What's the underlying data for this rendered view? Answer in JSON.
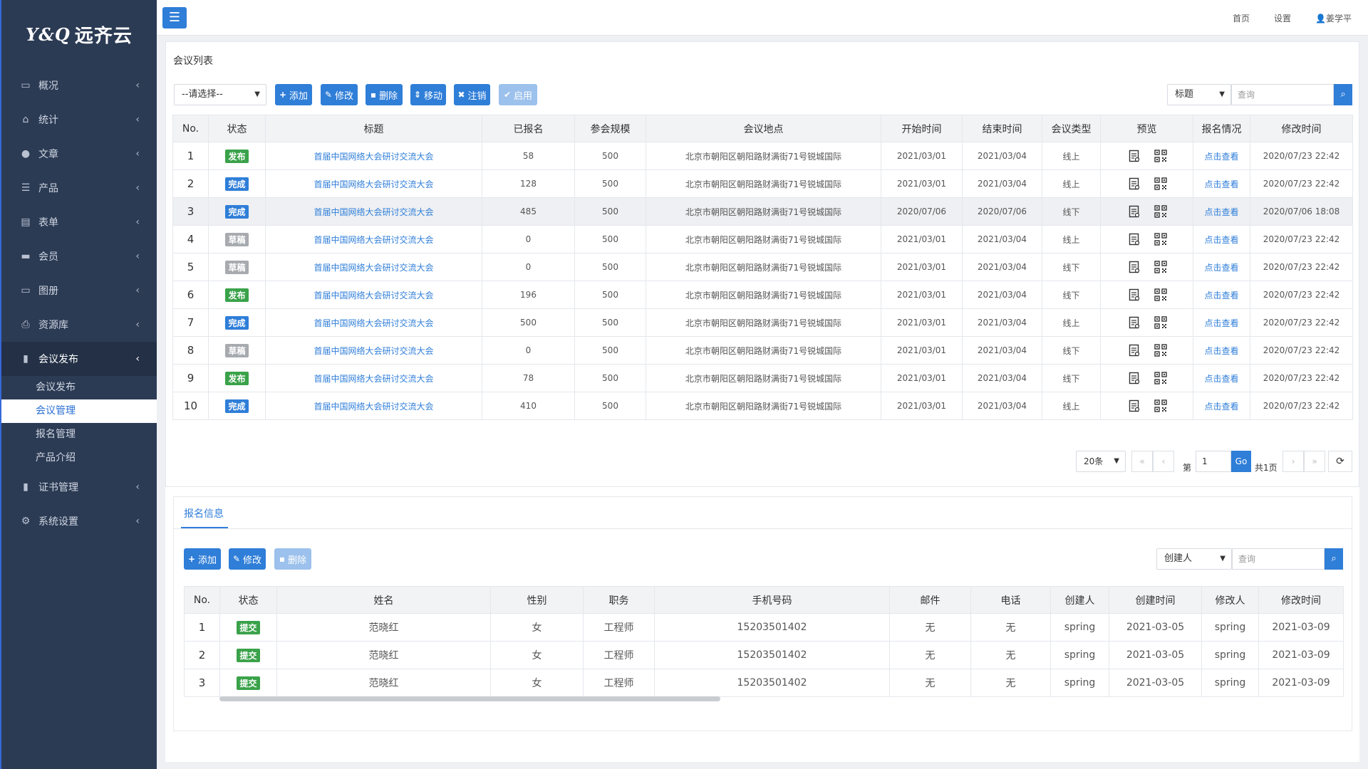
{
  "brand": {
    "mark": "Y&Q",
    "name": "远齐云"
  },
  "sidebar": {
    "items": [
      {
        "icon": "dashboard-icon",
        "glyph": "▭",
        "label": "概况"
      },
      {
        "icon": "chart-icon",
        "glyph": "⌂",
        "label": "统计"
      },
      {
        "icon": "user-icon",
        "glyph": "●",
        "label": "文章"
      },
      {
        "icon": "list-icon",
        "glyph": "☰",
        "label": "产品"
      },
      {
        "icon": "table-icon",
        "glyph": "▤",
        "label": "表单"
      },
      {
        "icon": "folder-icon",
        "glyph": "▬",
        "label": "会员"
      },
      {
        "icon": "card-icon",
        "glyph": "▭",
        "label": "图册"
      },
      {
        "icon": "printer-icon",
        "glyph": "⎙",
        "label": "资源库"
      },
      {
        "icon": "file-icon",
        "glyph": "▮",
        "label": "会议发布"
      }
    ],
    "sub_items": [
      "会议发布",
      "会议管理",
      "报名管理",
      "产品介绍"
    ],
    "items_after": [
      {
        "icon": "certificate-icon",
        "glyph": "▮",
        "label": "证书管理"
      },
      {
        "icon": "gear-icon",
        "glyph": "⚙",
        "label": "系统设置"
      }
    ]
  },
  "topbar": {
    "home": "首页",
    "settings": "设置",
    "user": "姜学平"
  },
  "panel1": {
    "title": "会议列表",
    "select_placeholder": "--请选择--",
    "buttons": {
      "add": "添加",
      "edit": "修改",
      "delete": "删除",
      "move": "移动",
      "cancel": "注销",
      "enable": "启用"
    },
    "search_field": "标题",
    "search_placeholder": "查询",
    "columns": [
      "No.",
      "状态",
      "标题",
      "已报名",
      "参会规模",
      "会议地点",
      "开始时间",
      "结束时间",
      "会议类型",
      "预览",
      "报名情况",
      "修改时间"
    ],
    "rows": [
      {
        "no": "1",
        "status": "发布",
        "status_type": "pub",
        "title": "首届中国网络大会研讨交流大会",
        "enrolled": "58",
        "scale": "500",
        "location": "北京市朝阳区朝阳路财满街71号锐城国际",
        "start": "2021/03/01",
        "end": "2021/03/04",
        "type": "线上",
        "link": "点击查看",
        "modified": "2020/07/23 22:42"
      },
      {
        "no": "2",
        "status": "完成",
        "status_type": "done",
        "title": "首届中国网络大会研讨交流大会",
        "enrolled": "128",
        "scale": "500",
        "location": "北京市朝阳区朝阳路财满街71号锐城国际",
        "start": "2021/03/01",
        "end": "2021/03/04",
        "type": "线上",
        "link": "点击查看",
        "modified": "2020/07/23 22:42"
      },
      {
        "no": "3",
        "status": "完成",
        "status_type": "done",
        "title": "首届中国网络大会研讨交流大会",
        "enrolled": "485",
        "scale": "500",
        "location": "北京市朝阳区朝阳路财满街71号锐城国际",
        "start": "2020/07/06",
        "end": "2020/07/06",
        "type": "线下",
        "link": "点击查看",
        "modified": "2020/07/06 18:08"
      },
      {
        "no": "4",
        "status": "草稿",
        "status_type": "draft",
        "title": "首届中国网络大会研讨交流大会",
        "enrolled": "0",
        "scale": "500",
        "location": "北京市朝阳区朝阳路财满街71号锐城国际",
        "start": "2021/03/01",
        "end": "2021/03/04",
        "type": "线上",
        "link": "点击查看",
        "modified": "2020/07/23 22:42"
      },
      {
        "no": "5",
        "status": "草稿",
        "status_type": "draft",
        "title": "首届中国网络大会研讨交流大会",
        "enrolled": "0",
        "scale": "500",
        "location": "北京市朝阳区朝阳路财满街71号锐城国际",
        "start": "2021/03/01",
        "end": "2021/03/04",
        "type": "线下",
        "link": "点击查看",
        "modified": "2020/07/23 22:42"
      },
      {
        "no": "6",
        "status": "发布",
        "status_type": "pub",
        "title": "首届中国网络大会研讨交流大会",
        "enrolled": "196",
        "scale": "500",
        "location": "北京市朝阳区朝阳路财满街71号锐城国际",
        "start": "2021/03/01",
        "end": "2021/03/04",
        "type": "线下",
        "link": "点击查看",
        "modified": "2020/07/23 22:42"
      },
      {
        "no": "7",
        "status": "完成",
        "status_type": "done",
        "title": "首届中国网络大会研讨交流大会",
        "enrolled": "500",
        "scale": "500",
        "location": "北京市朝阳区朝阳路财满街71号锐城国际",
        "start": "2021/03/01",
        "end": "2021/03/04",
        "type": "线上",
        "link": "点击查看",
        "modified": "2020/07/23 22:42"
      },
      {
        "no": "8",
        "status": "草稿",
        "status_type": "draft",
        "title": "首届中国网络大会研讨交流大会",
        "enrolled": "0",
        "scale": "500",
        "location": "北京市朝阳区朝阳路财满街71号锐城国际",
        "start": "2021/03/01",
        "end": "2021/03/04",
        "type": "线下",
        "link": "点击查看",
        "modified": "2020/07/23 22:42"
      },
      {
        "no": "9",
        "status": "发布",
        "status_type": "pub",
        "title": "首届中国网络大会研讨交流大会",
        "enrolled": "78",
        "scale": "500",
        "location": "北京市朝阳区朝阳路财满街71号锐城国际",
        "start": "2021/03/01",
        "end": "2021/03/04",
        "type": "线下",
        "link": "点击查看",
        "modified": "2020/07/23 22:42"
      },
      {
        "no": "10",
        "status": "完成",
        "status_type": "done",
        "title": "首届中国网络大会研讨交流大会",
        "enrolled": "410",
        "scale": "500",
        "location": "北京市朝阳区朝阳路财满街71号锐城国际",
        "start": "2021/03/01",
        "end": "2021/03/04",
        "type": "线上",
        "link": "点击查看",
        "modified": "2020/07/23 22:42"
      }
    ],
    "pagination": {
      "page_size": "20条",
      "page_prefix": "第",
      "page": "1",
      "go": "Go",
      "total": "共1页"
    }
  },
  "panel2": {
    "tab": "报名信息",
    "buttons": {
      "add": "添加",
      "edit": "修改",
      "delete": "删除"
    },
    "search_field": "创建人",
    "search_placeholder": "查询",
    "columns": [
      "No.",
      "状态",
      "姓名",
      "性别",
      "职务",
      "手机号码",
      "邮件",
      "电话",
      "创建人",
      "创建时间",
      "修改人",
      "修改时间"
    ],
    "rows": [
      {
        "no": "1",
        "status": "提交",
        "name": "范晓红",
        "gender": "女",
        "job": "工程师",
        "phone": "15203501402",
        "email": "无",
        "tel": "无",
        "creator": "spring",
        "created": "2021-03-05",
        "modifier": "spring",
        "modified": "2021-03-09"
      },
      {
        "no": "2",
        "status": "提交",
        "name": "范晓红",
        "gender": "女",
        "job": "工程师",
        "phone": "15203501402",
        "email": "无",
        "tel": "无",
        "creator": "spring",
        "created": "2021-03-05",
        "modifier": "spring",
        "modified": "2021-03-09"
      },
      {
        "no": "3",
        "status": "提交",
        "name": "范晓红",
        "gender": "女",
        "job": "工程师",
        "phone": "15203501402",
        "email": "无",
        "tel": "无",
        "creator": "spring",
        "created": "2021-03-05",
        "modifier": "spring",
        "modified": "2021-03-09"
      }
    ]
  },
  "colors": {
    "accent": "#2f7ed8",
    "sidebar": "#2c3b54",
    "published": "#3aa24a",
    "draft": "#a7aaaf"
  }
}
